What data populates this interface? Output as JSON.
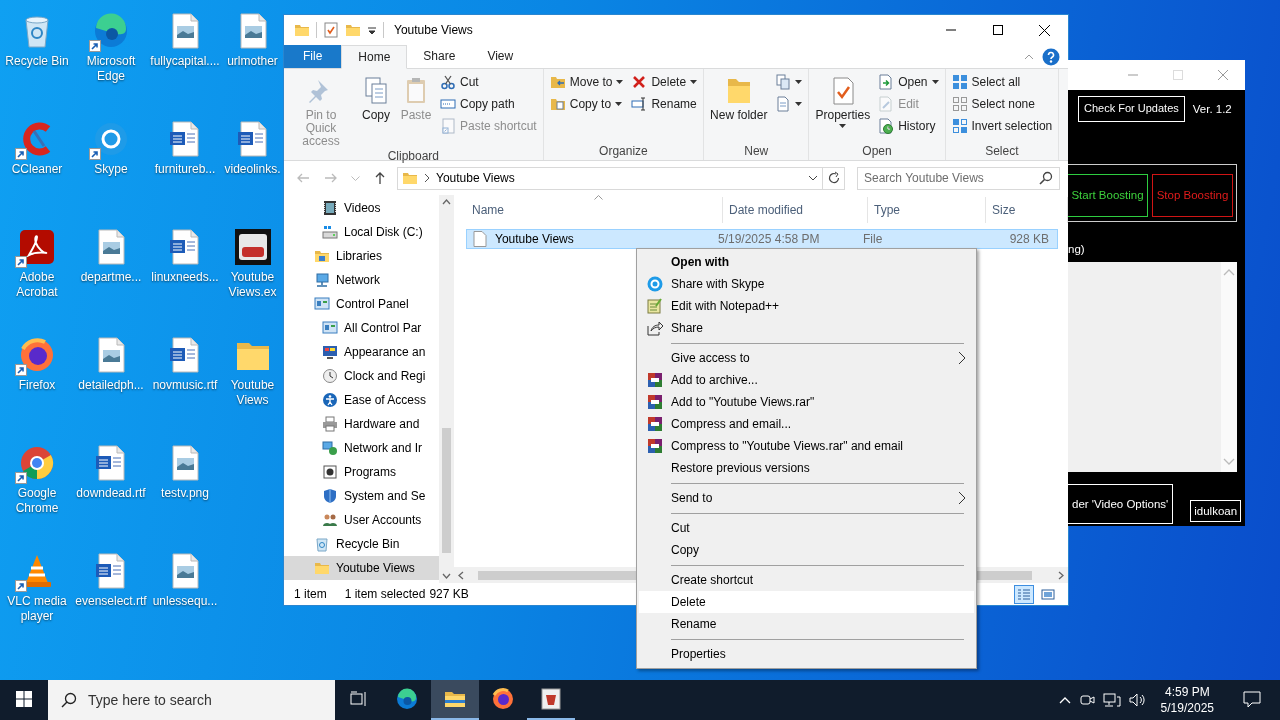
{
  "desktop": {
    "icons": [
      {
        "label": "Recycle Bin",
        "kind": "recycle",
        "shortcut": false
      },
      {
        "label": "CCleaner",
        "kind": "ccleaner",
        "shortcut": true
      },
      {
        "label": "Adobe Acrobat",
        "kind": "acrobat",
        "shortcut": true
      },
      {
        "label": "Firefox",
        "kind": "firefox",
        "shortcut": true
      },
      {
        "label": "Google Chrome",
        "kind": "chrome",
        "shortcut": true
      },
      {
        "label": "VLC media player",
        "kind": "vlc",
        "shortcut": true
      },
      {
        "label": "Microsoft Edge",
        "kind": "edge",
        "shortcut": true
      },
      {
        "label": "Skype",
        "kind": "skype",
        "shortcut": true
      },
      {
        "label": "departme...",
        "kind": "image",
        "shortcut": false
      },
      {
        "label": "detailedph...",
        "kind": "image",
        "shortcut": false
      },
      {
        "label": "downdead.rtf",
        "kind": "document",
        "shortcut": false
      },
      {
        "label": "evenselect.rtf",
        "kind": "document",
        "shortcut": false
      },
      {
        "label": "fullycapital....",
        "kind": "image",
        "shortcut": false
      },
      {
        "label": "furnitureb...",
        "kind": "document",
        "shortcut": false
      },
      {
        "label": "linuxneeds...",
        "kind": "document",
        "shortcut": false
      },
      {
        "label": "novmusic.rtf",
        "kind": "document",
        "shortcut": false
      },
      {
        "label": "testv.png",
        "kind": "image",
        "shortcut": false
      },
      {
        "label": "unlessequ...",
        "kind": "image",
        "shortcut": false
      },
      {
        "label": "urlmother",
        "kind": "image",
        "shortcut": false
      },
      {
        "label": "videolinks.",
        "kind": "document",
        "shortcut": false
      },
      {
        "label": "Youtube Views.ex",
        "kind": "video-app",
        "shortcut": false
      },
      {
        "label": "Youtube Views",
        "kind": "folder",
        "shortcut": false
      }
    ]
  },
  "explorer": {
    "title": "Youtube Views",
    "tabs": [
      {
        "label": "File",
        "kind": "file",
        "selected": false
      },
      {
        "label": "Home",
        "kind": "tab",
        "selected": true
      },
      {
        "label": "Share",
        "kind": "tab",
        "selected": false
      },
      {
        "label": "View",
        "kind": "tab",
        "selected": false
      }
    ],
    "ribbon": [
      {
        "label": "Clipboard",
        "columns": [
          [
            {
              "label": "Pin to Quick access",
              "kind": "large",
              "disabled": true,
              "dropdown": false
            }
          ],
          [
            {
              "label": "Copy",
              "kind": "large",
              "disabled": false,
              "dropdown": false
            }
          ],
          [
            {
              "label": "Paste",
              "kind": "large",
              "disabled": true,
              "dropdown": false
            }
          ],
          [
            {
              "label": "Cut",
              "kind": "small",
              "disabled": false,
              "dropdown": false
            },
            {
              "label": "Copy path",
              "kind": "small",
              "disabled": false,
              "dropdown": false
            },
            {
              "label": "Paste shortcut",
              "kind": "small",
              "disabled": true,
              "dropdown": false
            }
          ]
        ]
      },
      {
        "label": "Organize",
        "columns": [
          [
            {
              "label": "Move to",
              "kind": "small",
              "disabled": false,
              "dropdown": true
            },
            {
              "label": "Copy to",
              "kind": "small",
              "disabled": false,
              "dropdown": true
            }
          ],
          [
            {
              "label": "Delete",
              "kind": "small",
              "disabled": false,
              "dropdown": true
            },
            {
              "label": "Rename",
              "kind": "small",
              "disabled": false,
              "dropdown": false
            }
          ]
        ]
      },
      {
        "label": "New",
        "columns": [
          [
            {
              "label": "New folder",
              "kind": "large",
              "disabled": false,
              "dropdown": false
            }
          ],
          [
            {
              "kind": "icon",
              "disabled": false,
              "dropdown": true
            },
            {
              "kind": "icon",
              "disabled": false,
              "dropdown": true
            }
          ]
        ]
      },
      {
        "label": "Open",
        "columns": [
          [
            {
              "label": "Properties",
              "kind": "large",
              "disabled": false,
              "dropdown": true
            }
          ],
          [
            {
              "label": "Open",
              "kind": "small",
              "disabled": false,
              "dropdown": true
            },
            {
              "label": "Edit",
              "kind": "small",
              "disabled": true,
              "dropdown": false
            },
            {
              "label": "History",
              "kind": "small",
              "disabled": false,
              "dropdown": false
            }
          ]
        ]
      },
      {
        "label": "Select",
        "columns": [
          [
            {
              "label": "Select all",
              "kind": "small",
              "disabled": false,
              "dropdown": false
            },
            {
              "label": "Select none",
              "kind": "small",
              "disabled": false,
              "dropdown": false
            },
            {
              "label": "Invert selection",
              "kind": "small",
              "disabled": false,
              "dropdown": false
            }
          ]
        ]
      }
    ],
    "address": {
      "path": "Youtube Views"
    },
    "search": {
      "placeholder": "Search Youtube Views"
    },
    "nav": [
      {
        "children": [
          {
            "label": "Videos",
            "selected": false
          },
          {
            "label": "Local Disk (C:)",
            "selected": false
          }
        ]
      },
      {
        "label": "Libraries",
        "selected": false
      },
      {
        "label": "Network",
        "selected": false
      },
      {
        "label": "Control Panel",
        "selected": false,
        "children": [
          {
            "label": "All Control Par",
            "selected": false
          },
          {
            "label": "Appearance an",
            "selected": false
          },
          {
            "label": "Clock and Regi",
            "selected": false
          },
          {
            "label": "Ease of Access",
            "selected": false
          },
          {
            "label": "Hardware and",
            "selected": false
          },
          {
            "label": "Network and Ir",
            "selected": false
          },
          {
            "label": "Programs",
            "selected": false
          },
          {
            "label": "System and Se",
            "selected": false
          },
          {
            "label": "User Accounts",
            "selected": false
          }
        ]
      },
      {
        "label": "Recycle Bin",
        "selected": false
      },
      {
        "label": "Youtube Views",
        "selected": true
      }
    ],
    "columns": [
      {
        "label": "Name",
        "sorted": true
      },
      {
        "label": "Date modified",
        "sorted": false
      },
      {
        "label": "Type",
        "sorted": false
      },
      {
        "label": "Size",
        "sorted": false
      }
    ],
    "rows": [
      {
        "name": "Youtube Views",
        "date_modified": "5/19/2025 4:58 PM",
        "type": "File",
        "size": "928 KB",
        "selected": true
      }
    ],
    "status": {
      "count": "1 item",
      "selection": "1 item selected",
      "size": "927 KB"
    },
    "view_buttons": [
      {
        "selected": true
      },
      {
        "selected": false
      }
    ]
  },
  "context_menu": {
    "items": [
      {
        "label": "Open with",
        "kind": "default",
        "submenu": false,
        "highlighted": false
      },
      {
        "label": "Share with Skype",
        "kind": "item",
        "submenu": false,
        "highlighted": false
      },
      {
        "label": "Edit with Notepad++",
        "kind": "item",
        "submenu": false,
        "highlighted": false
      },
      {
        "label": "Share",
        "kind": "item",
        "submenu": false,
        "highlighted": false
      },
      {
        "kind": "separator"
      },
      {
        "label": "Give access to",
        "kind": "item",
        "submenu": true,
        "highlighted": false
      },
      {
        "label": "Add to archive...",
        "kind": "item",
        "submenu": false,
        "highlighted": false
      },
      {
        "label": "Add to \"Youtube Views.rar\"",
        "kind": "item",
        "submenu": false,
        "highlighted": false
      },
      {
        "label": "Compress and email...",
        "kind": "item",
        "submenu": false,
        "highlighted": false
      },
      {
        "label": "Compress to \"Youtube Views.rar\" and email",
        "kind": "item",
        "submenu": false,
        "highlighted": false
      },
      {
        "label": "Restore previous versions",
        "kind": "item",
        "submenu": false,
        "highlighted": false
      },
      {
        "kind": "separator"
      },
      {
        "label": "Send to",
        "kind": "item",
        "submenu": true,
        "highlighted": false
      },
      {
        "kind": "separator"
      },
      {
        "label": "Cut",
        "kind": "item",
        "submenu": false,
        "highlighted": false
      },
      {
        "label": "Copy",
        "kind": "item",
        "submenu": false,
        "highlighted": false
      },
      {
        "kind": "separator"
      },
      {
        "label": "Create shortcut",
        "kind": "item",
        "submenu": false,
        "highlighted": false
      },
      {
        "label": "Delete",
        "kind": "item",
        "submenu": false,
        "highlighted": true
      },
      {
        "label": "Rename",
        "kind": "item",
        "submenu": false,
        "highlighted": false
      },
      {
        "kind": "separator"
      },
      {
        "label": "Properties",
        "kind": "item",
        "submenu": false,
        "highlighted": false
      }
    ]
  },
  "app_window": {
    "maximize_disabled": true,
    "update_button": "Check For Updates",
    "version": "Ver. 1.2",
    "start_button": "Start Boosting",
    "stop_button": "Stop Boosting",
    "label_fragment": "ng)",
    "video_options_button": "der 'Video Options'",
    "user_box": "idulkoan"
  },
  "taskbar": {
    "search_placeholder": "Type here to search",
    "apps": [
      {
        "kind": "edge",
        "running": false,
        "active": false
      },
      {
        "kind": "explorer",
        "running": true,
        "active": true
      },
      {
        "kind": "firefox",
        "running": false,
        "active": false
      },
      {
        "kind": "app",
        "running": true,
        "active": false
      }
    ],
    "time": "4:59 PM",
    "date": "5/19/2025"
  }
}
